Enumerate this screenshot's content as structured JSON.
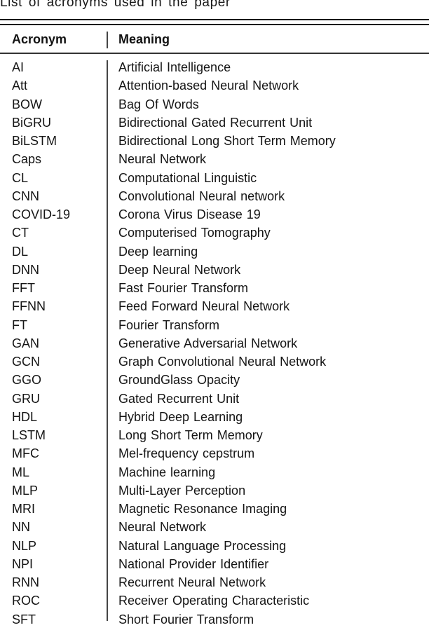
{
  "caption": "List of acronyms used in the paper",
  "table": {
    "headers": {
      "acronym": "Acronym",
      "meaning": "Meaning"
    },
    "rows": [
      {
        "acronym": "AI",
        "meaning": "Artificial Intelligence"
      },
      {
        "acronym": "Att",
        "meaning": "Attention-based Neural Network"
      },
      {
        "acronym": "BOW",
        "meaning": "Bag Of Words"
      },
      {
        "acronym": "BiGRU",
        "meaning": "Bidirectional Gated Recurrent Unit"
      },
      {
        "acronym": "BiLSTM",
        "meaning": "Bidirectional Long Short Term Memory"
      },
      {
        "acronym": "Caps",
        "meaning": "Neural Network"
      },
      {
        "acronym": "CL",
        "meaning": "Computational  Linguistic"
      },
      {
        "acronym": "CNN",
        "meaning": "Convolutional Neural network"
      },
      {
        "acronym": "COVID-19",
        "meaning": "Corona Virus Disease 19"
      },
      {
        "acronym": "CT",
        "meaning": "Computerised Tomography"
      },
      {
        "acronym": "DL",
        "meaning": "Deep learning"
      },
      {
        "acronym": "DNN",
        "meaning": "Deep Neural Network"
      },
      {
        "acronym": "FFT",
        "meaning": "Fast Fourier Transform"
      },
      {
        "acronym": "FFNN",
        "meaning": "Feed Forward Neural Network"
      },
      {
        "acronym": "FT",
        "meaning": "Fourier Transform"
      },
      {
        "acronym": "GAN",
        "meaning": "Generative Adversarial Network"
      },
      {
        "acronym": "GCN",
        "meaning": "Graph Convolutional Neural Network"
      },
      {
        "acronym": "GGO",
        "meaning": "GroundGlass Opacity"
      },
      {
        "acronym": "GRU",
        "meaning": "Gated Recurrent Unit"
      },
      {
        "acronym": "HDL",
        "meaning": "Hybrid Deep Learning"
      },
      {
        "acronym": "LSTM",
        "meaning": "Long Short Term Memory"
      },
      {
        "acronym": "MFC",
        "meaning": "Mel-frequency cepstrum"
      },
      {
        "acronym": "ML",
        "meaning": "Machine learning"
      },
      {
        "acronym": "MLP",
        "meaning": "Multi-Layer Perception"
      },
      {
        "acronym": "MRI",
        "meaning": "Magnetic Resonance Imaging"
      },
      {
        "acronym": "NN",
        "meaning": "Neural Network"
      },
      {
        "acronym": "NLP",
        "meaning": "Natural Language Processing"
      },
      {
        "acronym": "NPI",
        "meaning": "National Provider Identifier"
      },
      {
        "acronym": "RNN",
        "meaning": "Recurrent Neural Network"
      },
      {
        "acronym": "ROC",
        "meaning": "Receiver Operating Characteristic"
      },
      {
        "acronym": "SFT",
        "meaning": "Short Fourier Transform"
      }
    ]
  }
}
